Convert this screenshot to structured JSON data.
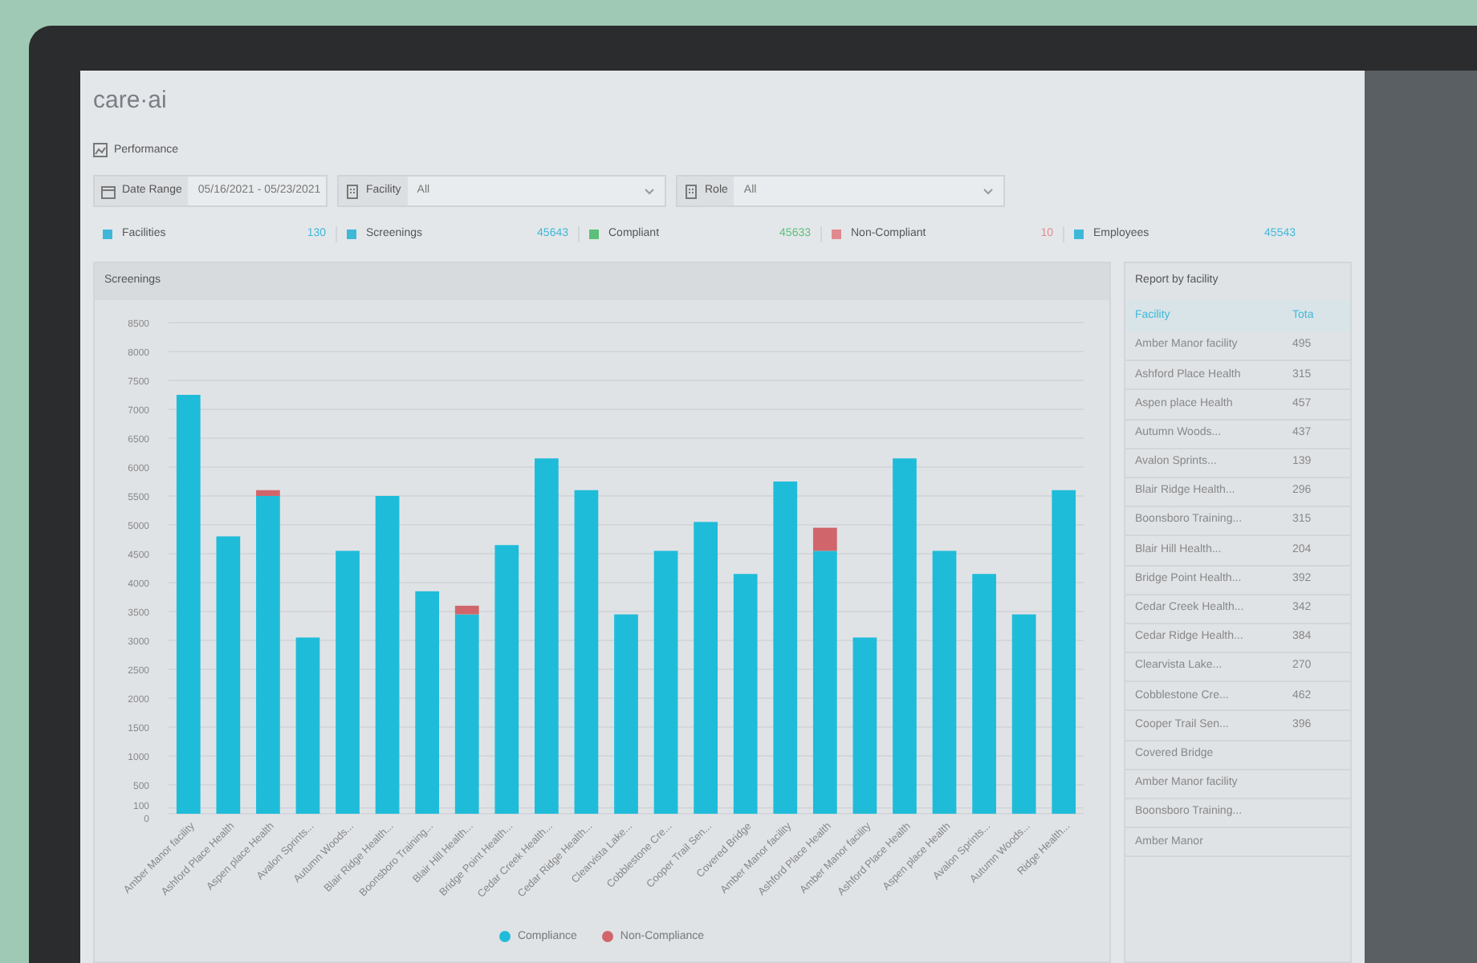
{
  "logo": "care·ai",
  "page_title": "Performance",
  "filters": [
    {
      "kind": "date",
      "label": "Date Range",
      "value": "05/16/2021 - 05/23/2021"
    },
    {
      "kind": "select",
      "label": "Facility",
      "value": "All"
    },
    {
      "kind": "select",
      "label": "Role",
      "value": "All"
    }
  ],
  "stats": [
    {
      "label": "Facilities",
      "value": "130",
      "color": "#3fb8d8"
    },
    {
      "label": "Screenings",
      "value": "45643",
      "color": "#3fb8d8"
    },
    {
      "label": "Compliant",
      "value": "45633",
      "color": "#5cbf7a"
    },
    {
      "label": "Non-Compliant",
      "value": "10",
      "color": "#e08a90"
    },
    {
      "label": "Employees",
      "value": "45543",
      "color": "#3fb8d8"
    }
  ],
  "screenings_panel": {
    "chart_data": {
      "type": "bar",
      "title": "Screenings",
      "stacked": true,
      "categories": [
        "Amber Manor facility",
        "Ashford Place Health",
        "Aspen place Health",
        "Avalon Sprints...",
        "Autumn Woods...",
        "Blair Ridge Health...",
        "Boonsboro Training...",
        "Blair Hill Health...",
        "Bridge Point Health...",
        "Cedar Creek Health...",
        "Cedar Ridge Health...",
        "Clearvista Lake...",
        "Cobblestone Cre...",
        "Cooper Trail Sen...",
        "Covered Bridge",
        "Amber Manor facility",
        "Ashford Place Health",
        "Amber Manor facility",
        "Ashford Place Health",
        "Aspen place Health",
        "Avalon Sprints...",
        "Autumn Woods...",
        "Ridge Health..."
      ],
      "grid": true,
      "legend": true,
      "ylim": [
        0,
        8500
      ],
      "yticks": [
        0,
        100,
        500,
        1000,
        1500,
        2000,
        2500,
        3000,
        3500,
        4000,
        4500,
        5000,
        5500,
        6000,
        6500,
        7000,
        7500,
        8000,
        8500
      ],
      "series": [
        {
          "name": "Compliance",
          "color": "#1fbcd9",
          "values": [
            7250,
            4800,
            5500,
            3050,
            4550,
            5500,
            3850,
            3450,
            4650,
            6150,
            5600,
            3450,
            4550,
            5050,
            4150,
            5750,
            4550,
            3050,
            6150,
            4550,
            4150,
            3450,
            5600
          ]
        },
        {
          "name": "Non-Compliance",
          "color": "#d0666b",
          "values": [
            0,
            0,
            100,
            0,
            0,
            0,
            0,
            150,
            0,
            0,
            0,
            0,
            0,
            0,
            0,
            0,
            400,
            0,
            0,
            0,
            0,
            0,
            0
          ]
        }
      ]
    }
  },
  "report": {
    "title": "Report by facility",
    "columns": [
      "Facility",
      "Tota"
    ],
    "rows": [
      [
        "Amber Manor facility",
        "495"
      ],
      [
        "Ashford Place Health",
        "315"
      ],
      [
        "Aspen place Health",
        "457"
      ],
      [
        "Autumn Woods...",
        "437"
      ],
      [
        "Avalon Sprints...",
        "139"
      ],
      [
        "Blair Ridge Health...",
        "296"
      ],
      [
        "Boonsboro Training...",
        "315"
      ],
      [
        "Blair Hill Health...",
        "204"
      ],
      [
        "Bridge Point Health...",
        "392"
      ],
      [
        "Cedar Creek Health...",
        "342"
      ],
      [
        "Cedar Ridge Health...",
        "384"
      ],
      [
        "Clearvista Lake...",
        "270"
      ],
      [
        "Cobblestone Cre...",
        "462"
      ],
      [
        "Cooper Trail Sen...",
        "396"
      ],
      [
        "Covered Bridge"
      ],
      [
        "Amber Manor facility"
      ],
      [
        "Boonsboro Training..."
      ],
      [
        "Amber Manor"
      ]
    ]
  }
}
